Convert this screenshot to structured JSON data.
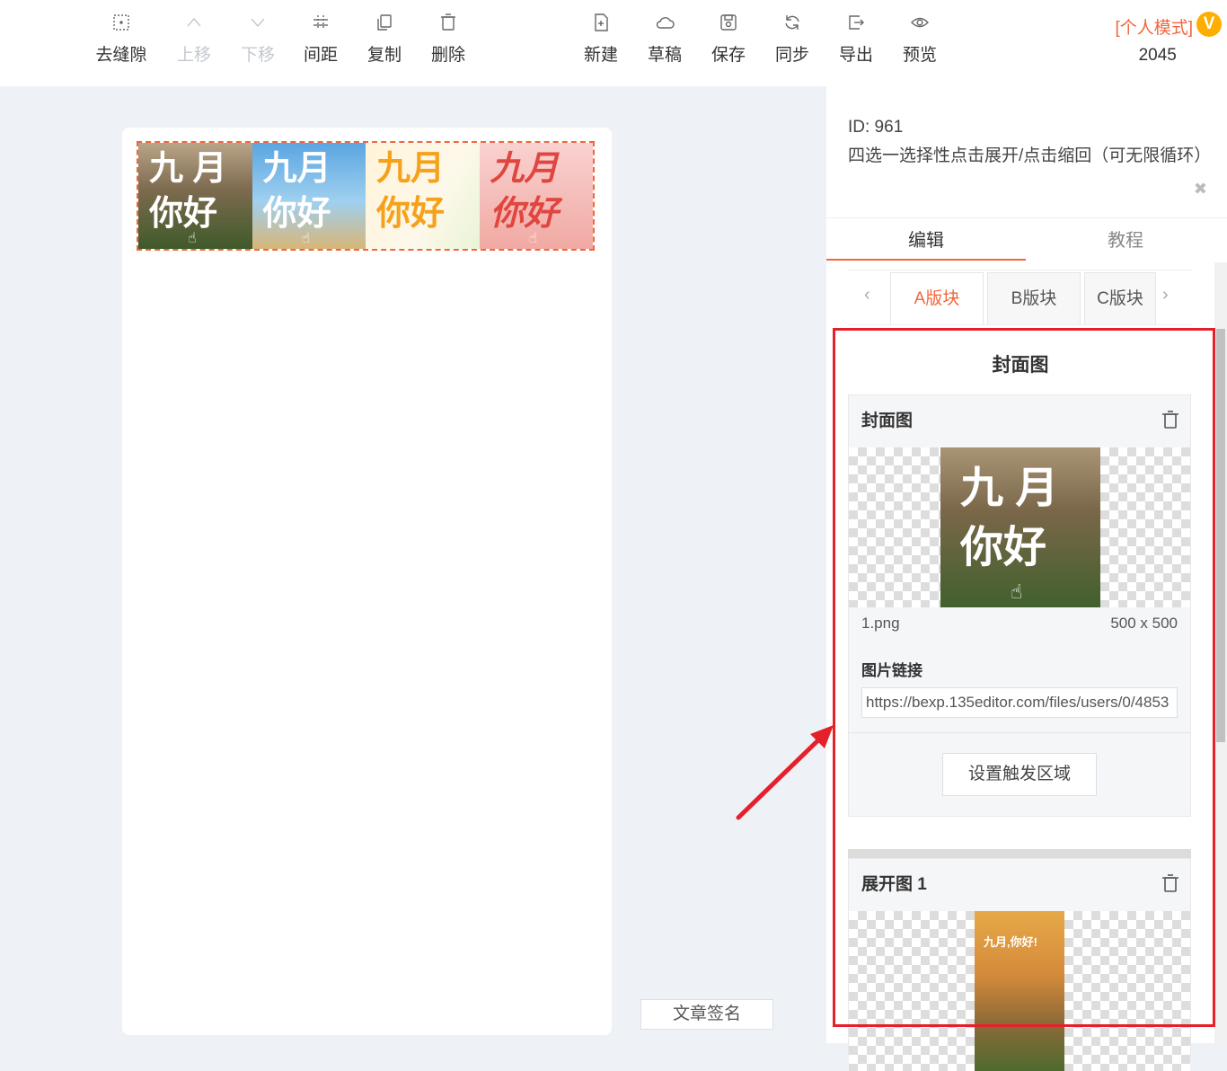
{
  "toolbar": {
    "left_tools": [
      {
        "id": "gap",
        "label": "去缝隙",
        "icon": "grid-dots-icon",
        "disabled": false
      },
      {
        "id": "up",
        "label": "上移",
        "icon": "chevron-up-icon",
        "disabled": true
      },
      {
        "id": "down",
        "label": "下移",
        "icon": "chevron-down-icon",
        "disabled": true
      },
      {
        "id": "spacing",
        "label": "间距",
        "icon": "spacing-icon",
        "disabled": false
      },
      {
        "id": "copy",
        "label": "复制",
        "icon": "copy-icon",
        "disabled": false
      },
      {
        "id": "delete",
        "label": "删除",
        "icon": "trash-icon",
        "disabled": false
      }
    ],
    "right_tools": [
      {
        "id": "new",
        "label": "新建",
        "icon": "new-file-icon"
      },
      {
        "id": "draft",
        "label": "草稿",
        "icon": "cloud-icon"
      },
      {
        "id": "save",
        "label": "保存",
        "icon": "save-icon"
      },
      {
        "id": "sync",
        "label": "同步",
        "icon": "sync-icon"
      },
      {
        "id": "export",
        "label": "导出",
        "icon": "export-icon"
      },
      {
        "id": "preview",
        "label": "预览",
        "icon": "eye-icon"
      }
    ],
    "mode_link": "[个人模式]",
    "mode_badge": "V",
    "mode_number": "2045"
  },
  "canvas": {
    "tiles": [
      {
        "line1": "九 月",
        "line2": "你好",
        "style": "a"
      },
      {
        "line1": "九月",
        "line2": "你好",
        "style": "b"
      },
      {
        "line1": "九月",
        "line2": "你好",
        "style": "c"
      },
      {
        "line1": "九月",
        "line2": "你好",
        "style": "d"
      }
    ],
    "signature_button": "文章签名"
  },
  "panel": {
    "id_line": "ID: 961",
    "description": "四选一选择性点击展开/点击缩回（可无限循环）",
    "tabs": [
      {
        "label": "编辑",
        "active": true
      },
      {
        "label": "教程",
        "active": false
      }
    ],
    "subtabs": [
      {
        "label": "A版块",
        "active": true
      },
      {
        "label": "B版块",
        "active": false
      },
      {
        "label": "C版块",
        "active": false
      }
    ],
    "section_title": "封面图",
    "cover_card": {
      "title": "封面图",
      "image_text_line1": "九 月",
      "image_text_line2": "你好",
      "filename": "1.png",
      "dimensions": "500 x 500",
      "link_label": "图片链接",
      "link_value": "https://bexp.135editor.com/files/users/0/4853",
      "trigger_button": "设置触发区域"
    },
    "expand_card": {
      "title": "展开图 1",
      "image_text": "九月,你好!"
    }
  },
  "colors": {
    "accent": "#f2663a",
    "annotation_red": "#e5202a",
    "badge": "#ffae00"
  }
}
